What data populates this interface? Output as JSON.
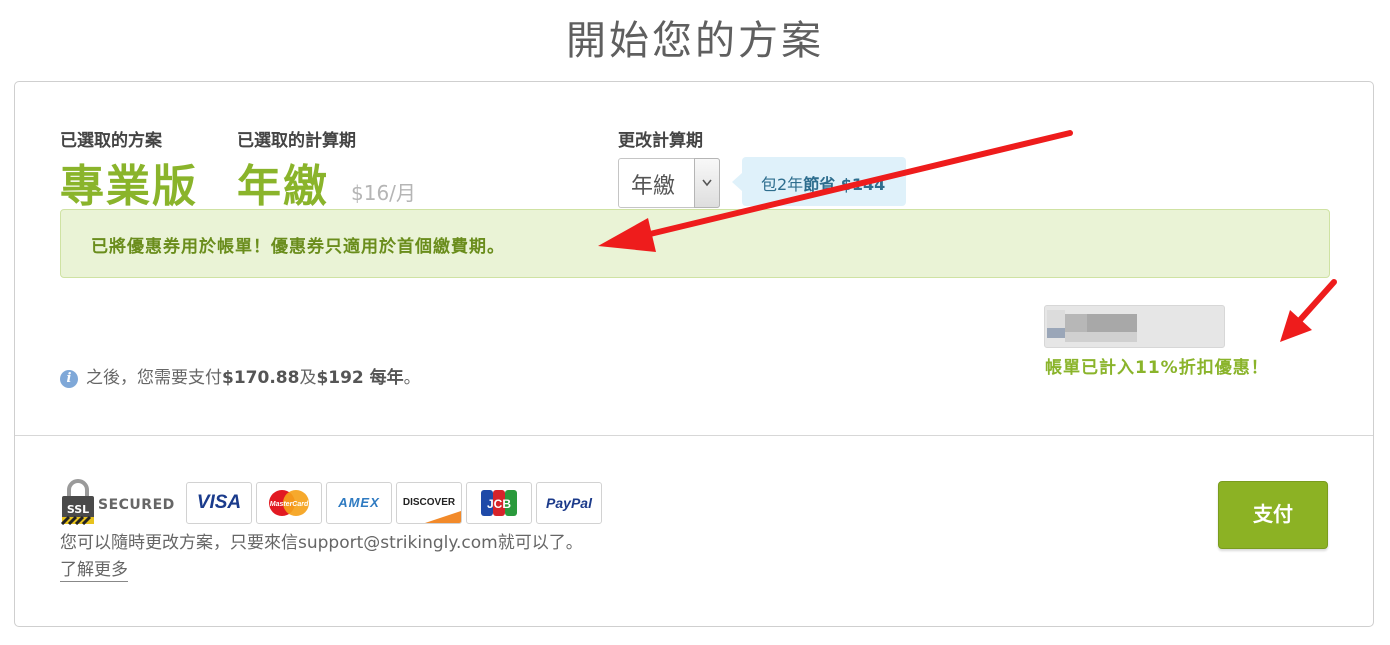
{
  "page_title": "開始您的方案",
  "plan": {
    "selected_plan_label": "已選取的方案",
    "selected_plan_value": "專業版",
    "selected_period_label": "已選取的計算期",
    "selected_period_value": "年繳",
    "price": "$16/月"
  },
  "change_period": {
    "label": "更改計算期",
    "selected": "年繳",
    "tip_prefix": "包2年",
    "tip_bold": "節省 $144"
  },
  "coupon_notice": "已將優惠券用於帳單！優惠券只適用於首個繳費期。",
  "discount_text": "帳單已計入11%折扣優惠！",
  "info": {
    "icon": "info-icon",
    "prefix": "之後，您需要支付",
    "amount1": "$170.88",
    "middle": "及",
    "amount2": "$192 每年",
    "suffix": "。"
  },
  "security": {
    "ssl_label": "SSL",
    "secured_label": "SECURED"
  },
  "payment_cards": [
    "VISA",
    "MasterCard",
    "AMEX",
    "DISCOVER",
    "JCB",
    "PayPal"
  ],
  "contact_text": "您可以隨時更改方案，只要來信support@strikingly.com就可以了。",
  "learn_more": "了解更多",
  "pay_button": "支付",
  "colors": {
    "brand_green": "#8ab42b",
    "button_green": "#8cb224",
    "annotation_red": "#ee1c1c"
  }
}
